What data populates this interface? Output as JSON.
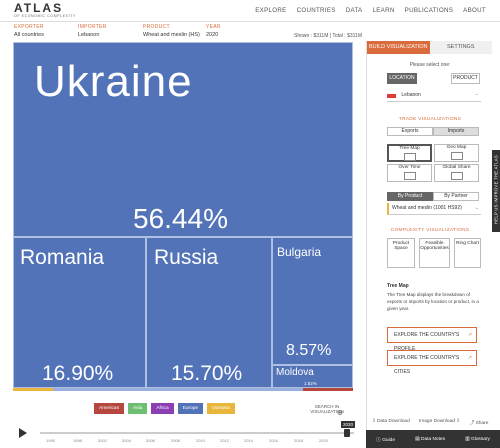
{
  "header": {
    "logo_main": "ATLAS",
    "logo_sub": "OF ECONOMIC COMPLEXITY",
    "nav": [
      "EXPLORE",
      "COUNTRIES",
      "DATA",
      "LEARN",
      "PUBLICATIONS",
      "ABOUT"
    ]
  },
  "selectors": {
    "exporter": {
      "label": "EXPORTER",
      "value": "All countries"
    },
    "importer": {
      "label": "IMPORTER",
      "value": "Lebanon"
    },
    "product": {
      "label": "PRODUCT",
      "value": "Wheat and meslin (HS)"
    },
    "year": {
      "label": "YEAR",
      "value": "2020"
    },
    "share": "Shown : $311M | Total : $311M"
  },
  "treemap": {
    "tiles": [
      {
        "name": "Ukraine",
        "percent": "56.44%"
      },
      {
        "name": "Romania",
        "percent": "16.90%"
      },
      {
        "name": "Russia",
        "percent": "15.70%"
      },
      {
        "name": "Bulgaria",
        "percent": "8.57%"
      },
      {
        "name": "Moldova",
        "percent": "1.62%"
      }
    ],
    "color_europe": "#5273b8"
  },
  "legend": {
    "items": [
      {
        "label": "Americas",
        "color": "#b5473f"
      },
      {
        "label": "Asia",
        "color": "#6fbf73"
      },
      {
        "label": "Africa",
        "color": "#8c3fb5"
      },
      {
        "label": "Europe",
        "color": "#5273b8"
      },
      {
        "label": "Oceania",
        "color": "#e8b63c"
      }
    ],
    "search_label": "SEARCH IN VISUALIZATION"
  },
  "timeline": {
    "years": [
      "1995",
      "1998",
      "2002",
      "2004",
      "2006",
      "2008",
      "2010",
      "2012",
      "2014",
      "2016",
      "2018",
      "2020"
    ],
    "current_year": "2020"
  },
  "panel": {
    "tab_build": "BUILD VISUALIZATION",
    "tab_settings": "SETTINGS",
    "please_select": "Please select one:",
    "location_btn": "LOCATION",
    "product_btn": "PRODUCT",
    "location_value": "Lebanon",
    "trade_title": "TRADE VISUALIZATIONS",
    "exports_btn": "Exports",
    "imports_btn": "Imports",
    "viz_cards": [
      "Tree Map",
      "Geo Map",
      "Over Time",
      "Global Share"
    ],
    "by_product": "By Product",
    "by_partner": "By Partner",
    "product_value": "Wheat and meslin (1001 HS92)",
    "complexity_title": "COMPLEXITY VISUALIZATIONS",
    "complexity_cards": [
      "Product Space",
      "Feasible Opportunities",
      "Ring Chart"
    ],
    "desc_title": "Tree Map",
    "desc_text": "The Tree Map displays the breakdown of exports or imports by location or product, in a given year.",
    "explore_profile": "EXPLORE THE COUNTRY'S PROFILE",
    "explore_cities": "EXPLORE THE COUNTRY'S CITIES",
    "footer": [
      "Data Download",
      "Image Download",
      "Share"
    ],
    "darkbar": [
      "Guide",
      "Data Notes",
      "Glossary"
    ],
    "help_tab": "HELP US IMPROVE THE ATLAS"
  }
}
